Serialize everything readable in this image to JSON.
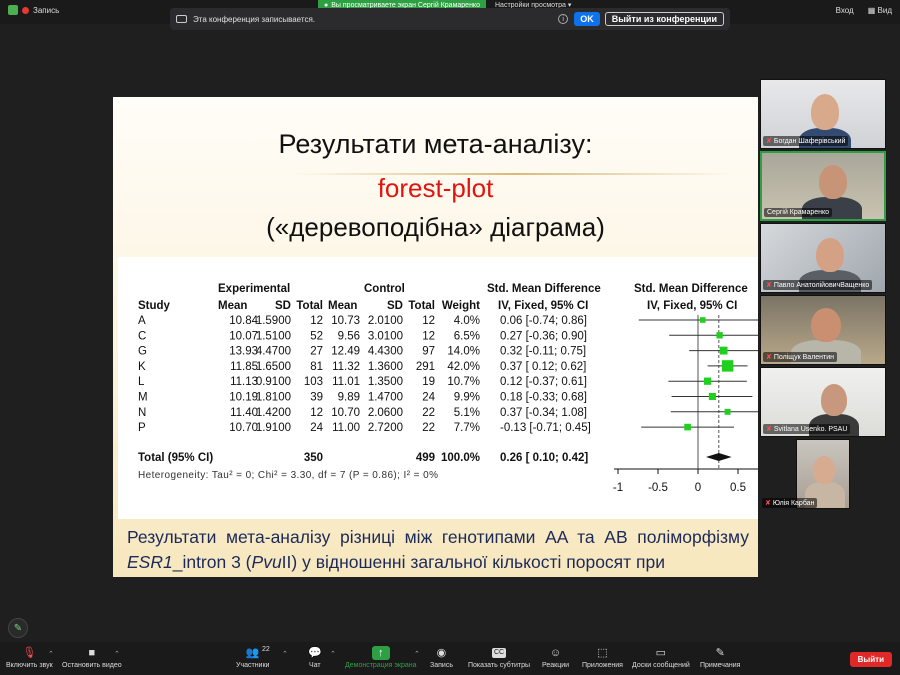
{
  "topbar": {
    "recording_label": "Запись",
    "sharing_pill": "Вы просматриваете экран Сергій Крамаренко",
    "view_settings": "Настройки просмотра",
    "login": "Вход",
    "view": "Вид"
  },
  "notice": {
    "text": "Эта конференция записывается.",
    "ok": "OK",
    "leave_conference": "Выйти из конференции"
  },
  "slide": {
    "title": "Результати мета-аналізу:",
    "subtitle_red": "forest-plot",
    "subtitle": "(«деревоподібна» діаграма)",
    "caption_part1": "Результати мета-аналізу різниці між генотипами AA та AB поліморфізму ",
    "caption_gene": "ESR1",
    "caption_part2": "_intron 3 (",
    "caption_enzyme": "Pvu",
    "caption_part3": "II) у відношенні загальної кількості поросят при"
  },
  "forest": {
    "group_experimental": "Experimental",
    "group_control": "Control",
    "smd_header": "Std. Mean Difference",
    "smd_sub": "IV, Fixed, 95% CI",
    "plot_header": "Std. Mean Difference",
    "plot_sub": "IV, Fixed, 95% CI",
    "col_study": "Study",
    "col_mean": "Mean",
    "col_sd": "SD",
    "col_total": "Total",
    "col_weight": "Weight",
    "rows": [
      {
        "study": "A",
        "e_mean": "10.84",
        "e_sd": "1.5900",
        "e_total": "12",
        "c_mean": "10.73",
        "c_sd": "2.0100",
        "c_total": "12",
        "weight": "4.0%",
        "ci": "0.06 [-0.74; 0.86]"
      },
      {
        "study": "C",
        "e_mean": "10.07",
        "e_sd": "1.5100",
        "e_total": "52",
        "c_mean": "9.56",
        "c_sd": "3.0100",
        "c_total": "12",
        "weight": "6.5%",
        "ci": "0.27 [-0.36; 0.90]"
      },
      {
        "study": "G",
        "e_mean": "13.93",
        "e_sd": "4.4700",
        "e_total": "27",
        "c_mean": "12.49",
        "c_sd": "4.4300",
        "c_total": "97",
        "weight": "14.0%",
        "ci": "0.32 [-0.11; 0.75]"
      },
      {
        "study": "K",
        "e_mean": "11.85",
        "e_sd": "1.6500",
        "e_total": "81",
        "c_mean": "11.32",
        "c_sd": "1.3600",
        "c_total": "291",
        "weight": "42.0%",
        "ci": "0.37 [ 0.12; 0.62]"
      },
      {
        "study": "L",
        "e_mean": "11.13",
        "e_sd": "0.9100",
        "e_total": "103",
        "c_mean": "11.01",
        "c_sd": "1.3500",
        "c_total": "19",
        "weight": "10.7%",
        "ci": "0.12 [-0.37; 0.61]"
      },
      {
        "study": "M",
        "e_mean": "10.19",
        "e_sd": "1.8100",
        "e_total": "39",
        "c_mean": "9.89",
        "c_sd": "1.4700",
        "c_total": "24",
        "weight": "9.9%",
        "ci": "0.18 [-0.33; 0.68]"
      },
      {
        "study": "N",
        "e_mean": "11.40",
        "e_sd": "1.4200",
        "e_total": "12",
        "c_mean": "10.70",
        "c_sd": "2.0600",
        "c_total": "22",
        "weight": "5.1%",
        "ci": "0.37 [-0.34; 1.08]"
      },
      {
        "study": "P",
        "e_mean": "10.70",
        "e_sd": "1.9100",
        "e_total": "24",
        "c_mean": "11.00",
        "c_sd": "2.7200",
        "c_total": "22",
        "weight": "7.7%",
        "ci": "-0.13 [-0.71; 0.45]"
      }
    ],
    "total": {
      "label": "Total (95% CI)",
      "e_total": "350",
      "c_total": "499",
      "weight": "100.0%",
      "ci": "0.26 [ 0.10; 0.42]"
    },
    "heterogeneity": "Heterogeneity: Tau² = 0; Chi² = 3.30, df = 7 (P = 0.86); I² = 0%",
    "axis_ticks": [
      "-1",
      "-0.5",
      "0",
      "0.5"
    ]
  },
  "chart_data": {
    "type": "scatter",
    "title": "",
    "xlabel": "",
    "ylabel": "",
    "xlim": [
      -1,
      0.75
    ],
    "x_ticks": [
      -1,
      -0.5,
      0,
      0.5
    ],
    "categories": [
      "A",
      "C",
      "G",
      "K",
      "L",
      "M",
      "N",
      "P",
      "Total (95% CI)"
    ],
    "estimates": [
      0.06,
      0.27,
      0.32,
      0.37,
      0.12,
      0.18,
      0.37,
      -0.13,
      0.26
    ],
    "ci_lower": [
      -0.74,
      -0.36,
      -0.11,
      0.12,
      -0.37,
      -0.33,
      -0.34,
      -0.71,
      0.1
    ],
    "ci_upper": [
      0.86,
      0.9,
      0.75,
      0.62,
      0.61,
      0.68,
      1.08,
      0.45,
      0.42
    ],
    "weights_percent": [
      4.0,
      6.5,
      14.0,
      42.0,
      10.7,
      9.9,
      5.1,
      7.7,
      100.0
    ],
    "pooled_line": 0.26,
    "marker_color": "#1fd01f"
  },
  "participants": [
    {
      "name": "Богдан Шаферівський",
      "muted": true
    },
    {
      "name": "Сергій Крамаренко",
      "muted": false
    },
    {
      "name": "Павло АнатолійовичВащенко",
      "muted": true
    },
    {
      "name": "Поліщук Валентин",
      "muted": true
    },
    {
      "name": "Svitlana Usenko. PSAU",
      "muted": true
    },
    {
      "name": "Юлія Карбан",
      "muted": true
    }
  ],
  "toolbar": {
    "audio": "Включить звук",
    "video": "Остановить видео",
    "participants": "Участники",
    "participants_count": "22",
    "chat": "Чат",
    "share": "Демонстрация экрана",
    "record": "Запись",
    "captions": "Показать субтитры",
    "reactions": "Реакции",
    "apps": "Приложения",
    "whiteboards": "Доски сообщений",
    "notes": "Примечания",
    "leave": "Выйти",
    "cc_badge": "CC"
  },
  "colors": {
    "share_green": "#2ea043",
    "leave_red": "#e02828",
    "ok_blue": "#0e72ed",
    "title_red": "#e3140e",
    "caption_blue": "#1c2a5a"
  }
}
